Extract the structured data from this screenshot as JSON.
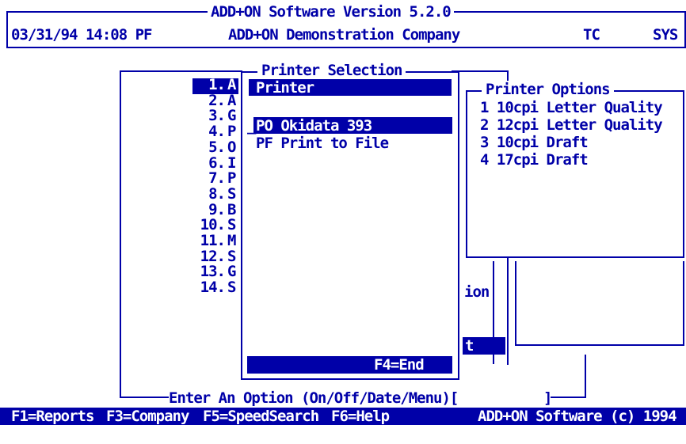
{
  "header": {
    "title": "ADD+ON Software Version 5.2.0",
    "datetime": "03/31/94 14:08 PF",
    "company": "ADD+ON Demonstration Company",
    "user_code": "TC",
    "system_code": "SYS"
  },
  "main_menu": {
    "numbers": [
      "1.",
      "2.",
      "3.",
      "4.",
      "5.",
      "6.",
      "7.",
      "8.",
      "9.",
      "10.",
      "11.",
      "12.",
      "13.",
      "14."
    ],
    "letters": [
      "A",
      "A",
      "G",
      "P",
      "O",
      "I",
      "P",
      "S",
      "B",
      "S",
      "M",
      "S",
      "G",
      "S"
    ],
    "prompt": "Enter An Option (On/Off/Date/Menu)[",
    "prompt_end": "]",
    "right_fragment_1": "ion",
    "right_fragment_2": "t"
  },
  "printer_selection": {
    "title": "Printer Selection",
    "header_label": "Printer",
    "printers": [
      "PO Okidata 393",
      "PF Print to File"
    ],
    "end_key": "F4=End"
  },
  "printer_options": {
    "title": "Printer Options",
    "options": [
      "1 10cpi Letter Quality",
      "2 12cpi Letter Quality",
      "3 10cpi Draft",
      "4 17cpi Draft"
    ]
  },
  "function_bar": {
    "keys": [
      "F1=Reports",
      "F3=Company",
      "F5=SpeedSearch",
      "F6=Help"
    ],
    "copyright": "ADD+ON Software (c) 1994"
  },
  "colors": {
    "primary": "#0000a8",
    "background": "#ffffff",
    "inverse_text": "#ffffff"
  }
}
